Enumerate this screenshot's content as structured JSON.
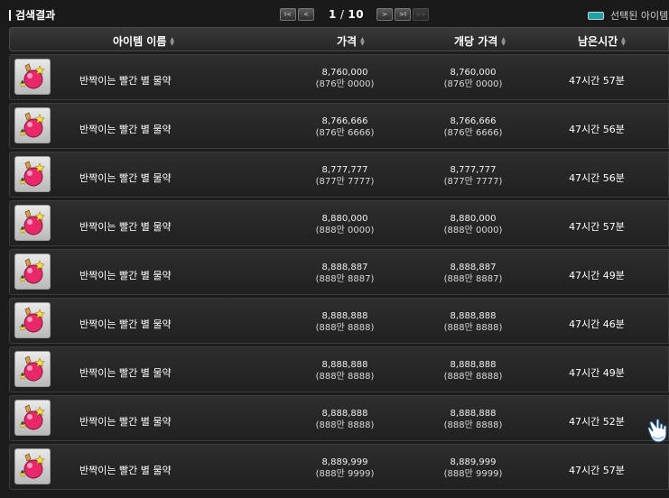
{
  "title": "검색결과",
  "pagination": {
    "current": "1",
    "separator": "/",
    "total": "10",
    "first_label": "I<",
    "prev_label": "<",
    "next_label": ">",
    "next10_label": ">I",
    "last_label": ">>"
  },
  "legend": {
    "label": "선택된 아이템",
    "color": "#1aa3a8"
  },
  "columns": {
    "name": "아이템 이름",
    "price": "가격",
    "unit_price": "개당 가격",
    "time_left": "남은시간"
  },
  "rows": [
    {
      "name": "반짝이는 빨간 별 물약",
      "price": "8,760,000",
      "price_kr": "(876만 0000)",
      "unit": "8,760,000",
      "unit_kr": "(876만 0000)",
      "time": "47시간 57분"
    },
    {
      "name": "반짝이는 빨간 별 물약",
      "price": "8,766,666",
      "price_kr": "(876만 6666)",
      "unit": "8,766,666",
      "unit_kr": "(876만 6666)",
      "time": "47시간 56분"
    },
    {
      "name": "반짝이는 빨간 별 물약",
      "price": "8,777,777",
      "price_kr": "(877만 7777)",
      "unit": "8,777,777",
      "unit_kr": "(877만 7777)",
      "time": "47시간 56분"
    },
    {
      "name": "반짝이는 빨간 별 물약",
      "price": "8,880,000",
      "price_kr": "(888만 0000)",
      "unit": "8,880,000",
      "unit_kr": "(888만 0000)",
      "time": "47시간 57분"
    },
    {
      "name": "반짝이는 빨간 별 물약",
      "price": "8,888,887",
      "price_kr": "(888만 8887)",
      "unit": "8,888,887",
      "unit_kr": "(888만 8887)",
      "time": "47시간 49분"
    },
    {
      "name": "반짝이는 빨간 별 물약",
      "price": "8,888,888",
      "price_kr": "(888만 8888)",
      "unit": "8,888,888",
      "unit_kr": "(888만 8888)",
      "time": "47시간 46분"
    },
    {
      "name": "반짝이는 빨간 별 물약",
      "price": "8,888,888",
      "price_kr": "(888만 8888)",
      "unit": "8,888,888",
      "unit_kr": "(888만 8888)",
      "time": "47시간 49분"
    },
    {
      "name": "반짝이는 빨간 별 물약",
      "price": "8,888,888",
      "price_kr": "(888만 8888)",
      "unit": "8,888,888",
      "unit_kr": "(888만 8888)",
      "time": "47시간 52분"
    },
    {
      "name": "반짝이는 빨간 별 물약",
      "price": "8,889,999",
      "price_kr": "(888만 9999)",
      "unit": "8,889,999",
      "unit_kr": "(888만 9999)",
      "time": "47시간 57분"
    }
  ]
}
